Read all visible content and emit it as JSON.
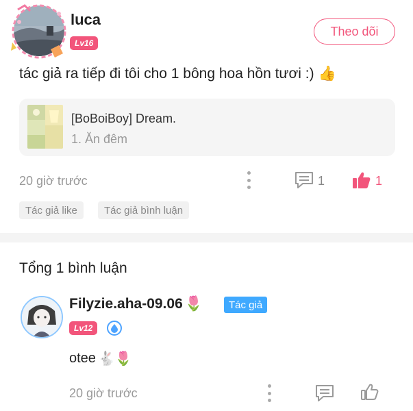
{
  "post": {
    "username": "luca",
    "level": "Lv16",
    "follow_label": "Theo dõi",
    "text": "tác giả ra tiếp đi tôi cho 1 bông hoa hồn tươi :)",
    "text_emoji": "👍",
    "story": {
      "title": "[BoBoiBoy] Dream.",
      "chapter": "1. Ăn đêm"
    },
    "time": "20 giờ trước",
    "comment_count": "1",
    "like_count": "1",
    "tags": [
      "Tác giả like",
      "Tác giả bình luận"
    ]
  },
  "comments_header": "Tổng 1 bình luận",
  "comment": {
    "username": "Filyzie.aha-09.06",
    "name_emoji": "🌷",
    "author_tag": "Tác giả",
    "level": "Lv12",
    "text": "otee",
    "text_emoji": "🐇🌷",
    "time": "20 giờ trước"
  },
  "colors": {
    "accent": "#f2557b",
    "author_blue": "#3fa9ff",
    "muted": "#999999"
  }
}
